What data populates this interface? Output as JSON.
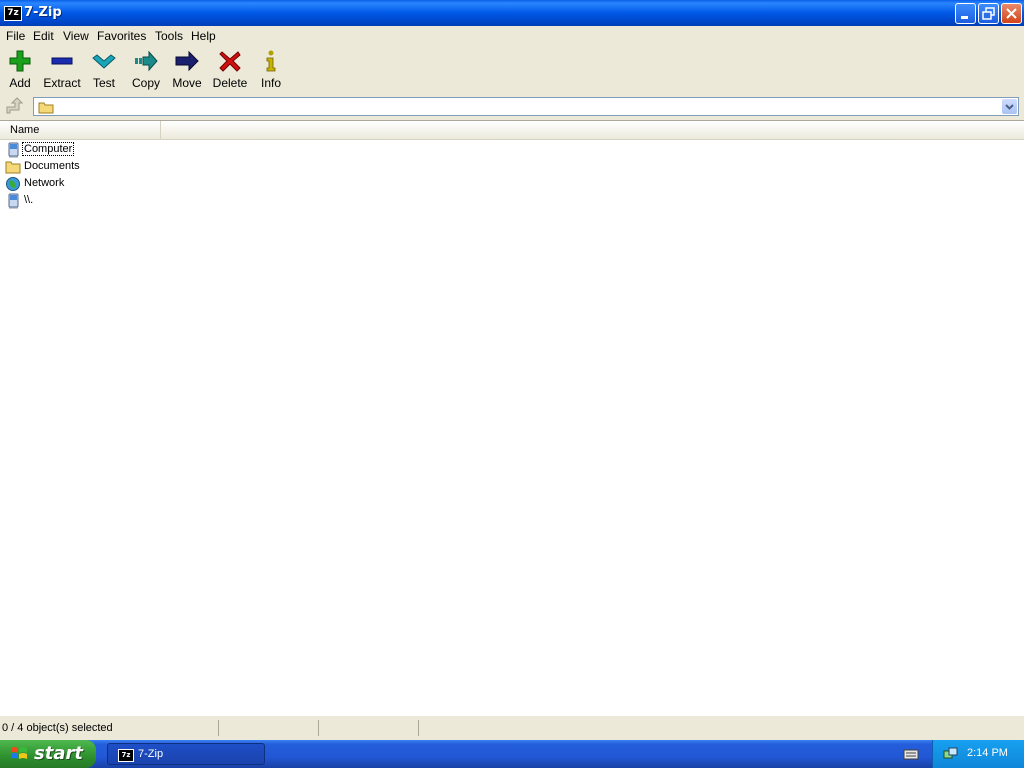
{
  "window": {
    "title": "7-Zip",
    "app_icon_text": "7z"
  },
  "menu": [
    "File",
    "Edit",
    "View",
    "Favorites",
    "Tools",
    "Help"
  ],
  "toolbar": [
    {
      "label": "Add",
      "icon": "add-icon",
      "color": "#1aa01a"
    },
    {
      "label": "Extract",
      "icon": "extract-icon",
      "color": "#1a2bb0"
    },
    {
      "label": "Test",
      "icon": "test-icon",
      "color": "#18a6b8"
    },
    {
      "label": "Copy",
      "icon": "copy-icon",
      "color": "#1a8a8a"
    },
    {
      "label": "Move",
      "icon": "move-icon",
      "color": "#1a1f6e"
    },
    {
      "label": "Delete",
      "icon": "delete-icon",
      "color": "#d01010"
    },
    {
      "label": "Info",
      "icon": "info-icon",
      "color": "#b0a000"
    }
  ],
  "address": {
    "value": ""
  },
  "list": {
    "columns": [
      "Name"
    ],
    "items": [
      {
        "name": "Computer",
        "icon": "computer-icon",
        "focused": true
      },
      {
        "name": "Documents",
        "icon": "folder-icon"
      },
      {
        "name": "Network",
        "icon": "network-icon"
      },
      {
        "name": "\\\\.",
        "icon": "device-icon"
      }
    ]
  },
  "status": {
    "text": "0 / 4 object(s) selected"
  },
  "taskbar": {
    "start_label": "start",
    "task_label": "7-Zip",
    "task_icon_text": "7z",
    "clock": "2:14 PM"
  }
}
